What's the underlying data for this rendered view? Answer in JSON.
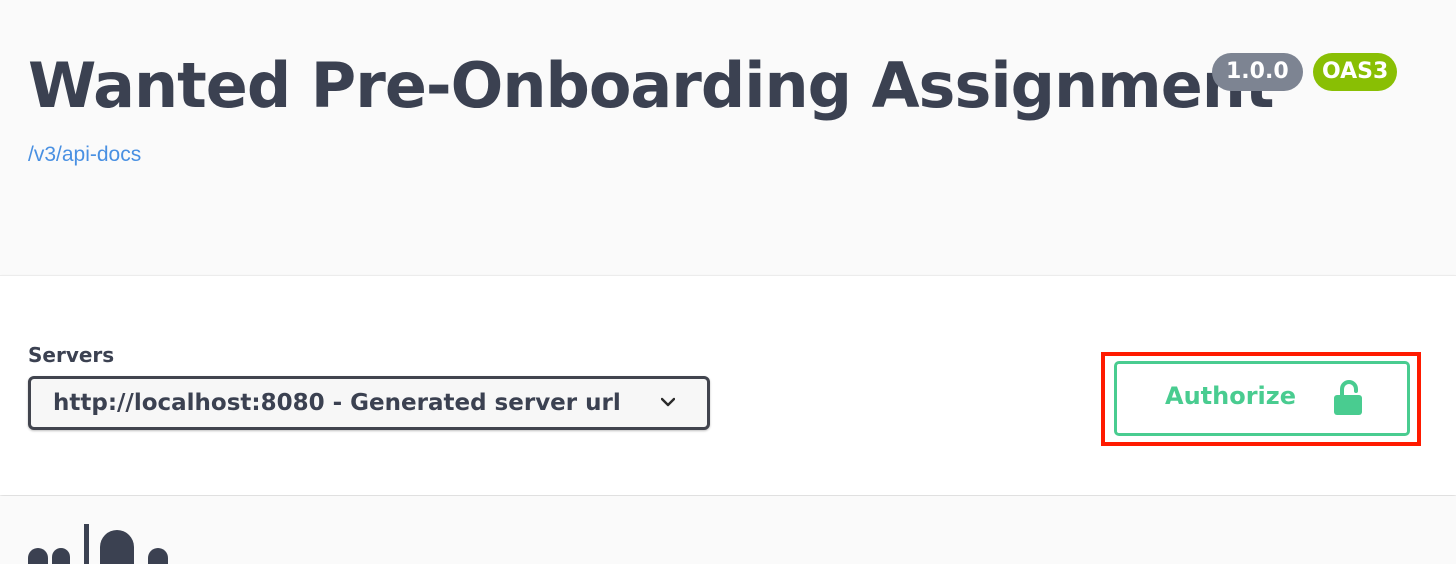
{
  "info": {
    "title": "Wanted Pre-Onboarding Assignment",
    "version": "1.0.0",
    "oas_badge": "OAS3",
    "spec_link": "/v3/api-docs"
  },
  "servers": {
    "label": "Servers",
    "selected": "http://localhost:8080 - Generated server url",
    "icon": "chevron-down-icon"
  },
  "authorize": {
    "label": "Authorize",
    "icon": "unlocked-padlock-icon",
    "highlight_color": "#ff1a00",
    "accent_color": "#49cc90"
  }
}
